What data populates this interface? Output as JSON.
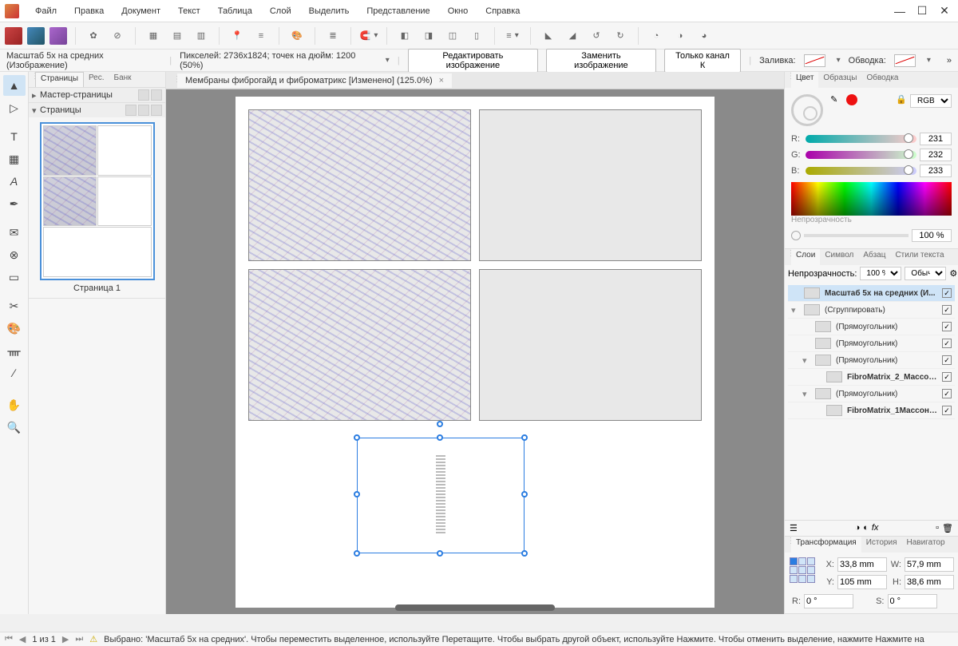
{
  "menu": [
    "Файл",
    "Правка",
    "Документ",
    "Текст",
    "Таблица",
    "Слой",
    "Выделить",
    "Представление",
    "Окно",
    "Справка"
  ],
  "context": {
    "desc": "Масштаб 5х на средних (Изображение)",
    "pixels": "Пикселей: 2736x1824; точек на дюйм: 1200 (50%)",
    "edit": "Редактировать изображение",
    "replace": "Заменить изображение",
    "channel": "Только канал К",
    "fill_label": "Заливка:",
    "stroke_label": "Обводка:"
  },
  "doc_tab": "Мембраны фиброгайд и фиброматрикс [Изменено] (125.0%)",
  "pages_panel": {
    "tabs": [
      "Страницы",
      "Рес.",
      "Банк"
    ],
    "master": "Мастер-страницы",
    "pages": "Страницы",
    "page_label": "Страница 1"
  },
  "color_panel": {
    "tabs": [
      "Цвет",
      "Образцы",
      "Обводка"
    ],
    "mode": "RGB",
    "r": "231",
    "g": "232",
    "b": "233",
    "opacity_label": "Непрозрачность",
    "opacity": "100 %"
  },
  "layers_panel": {
    "tabs": [
      "Слои",
      "Символ",
      "Абзац",
      "Стили текста"
    ],
    "opacity_label": "Непрозрачность:",
    "opacity": "100 %",
    "blend": "Обычн",
    "layers": [
      {
        "name": "Масштаб 5х на средних (И...",
        "selected": true,
        "bold": true,
        "indent": 0,
        "tri": false
      },
      {
        "name": "(Сгруппировать)",
        "indent": 0,
        "tri": true
      },
      {
        "name": "(Прямоугольник)",
        "indent": 1,
        "tri": false
      },
      {
        "name": "(Прямоугольник)",
        "indent": 1,
        "tri": false
      },
      {
        "name": "(Прямоугольник)",
        "indent": 1,
        "tri": true
      },
      {
        "name": "FibroMatrix_2_Массон (...",
        "indent": 2,
        "tri": false,
        "bold": true
      },
      {
        "name": "(Прямоугольник)",
        "indent": 1,
        "tri": true
      },
      {
        "name": "FibroMatrix_1Массон (...",
        "indent": 2,
        "tri": false,
        "bold": true
      }
    ]
  },
  "transform_panel": {
    "tabs": [
      "Трансформация",
      "История",
      "Навигатор"
    ],
    "x": "33,8 mm",
    "y": "105 mm",
    "w": "57,9 mm",
    "h": "38,6 mm",
    "r": "0 °",
    "s": "0 °"
  },
  "status": {
    "pages": "1 из 1",
    "hint": "Выбрано: 'Масштаб 5х на средних'. Чтобы переместить выделенное, используйте Перетащите. Чтобы выбрать другой объект, используйте Нажмите. Чтобы отменить выделение, нажмите Нажмите на"
  }
}
